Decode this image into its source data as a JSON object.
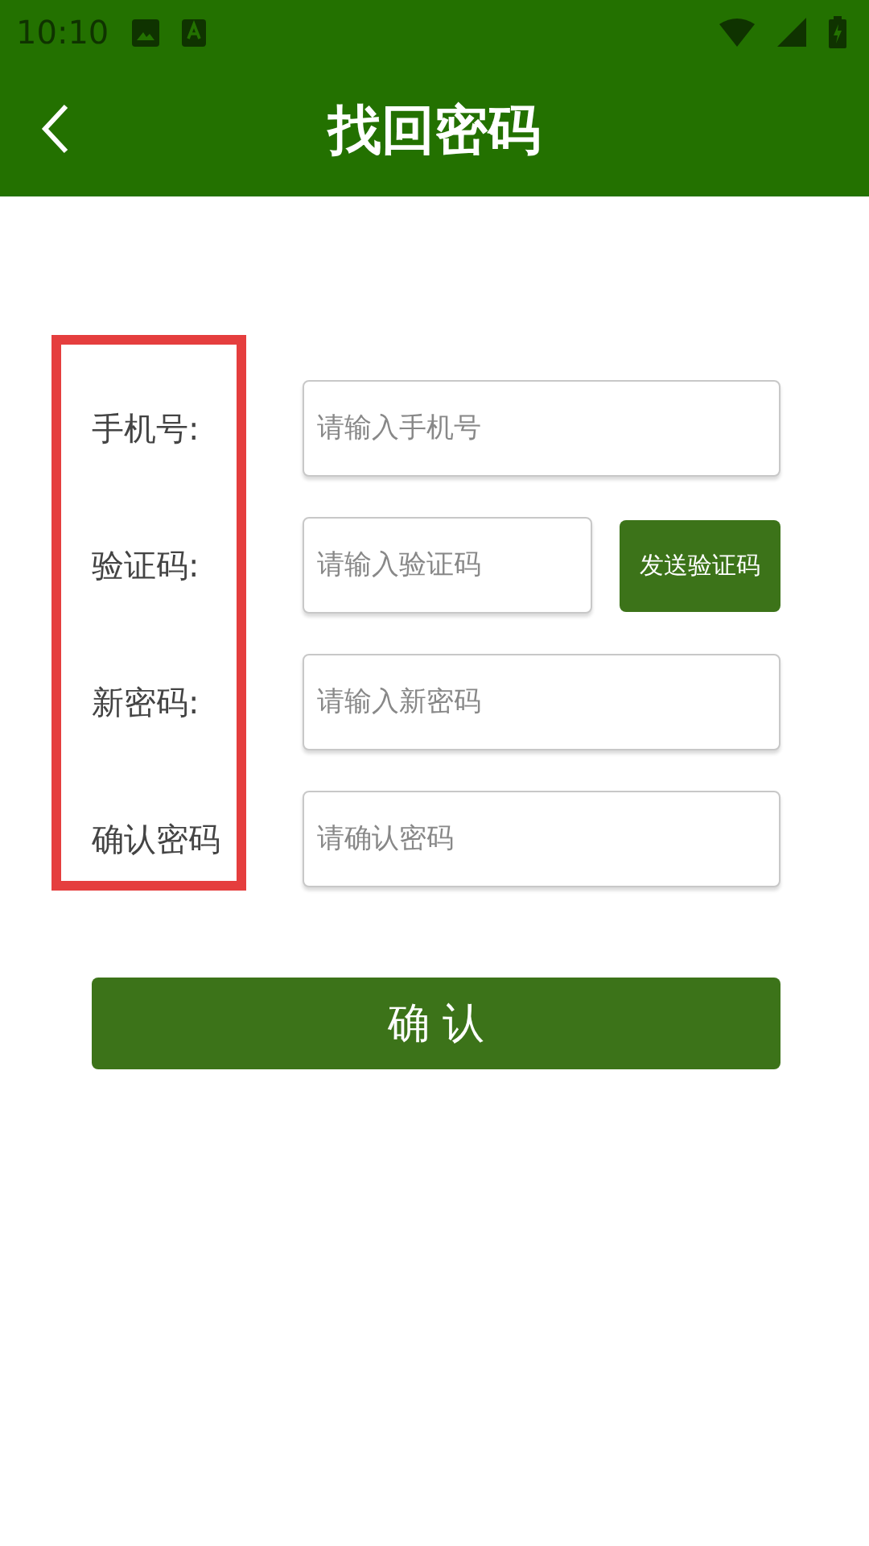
{
  "status_bar": {
    "time": "10:10"
  },
  "app_bar": {
    "title": "找回密码"
  },
  "form": {
    "fields": [
      {
        "kind": "text",
        "label": "手机号:",
        "placeholder": "请输入手机号"
      },
      {
        "kind": "code",
        "label": "验证码:",
        "placeholder": "请输入验证码",
        "button": "发送验证码"
      },
      {
        "kind": "text",
        "label": "新密码:",
        "placeholder": "请输入新密码"
      },
      {
        "kind": "text",
        "label": "确认密码",
        "placeholder": "请确认密码"
      }
    ]
  },
  "confirm_button": "确 认"
}
